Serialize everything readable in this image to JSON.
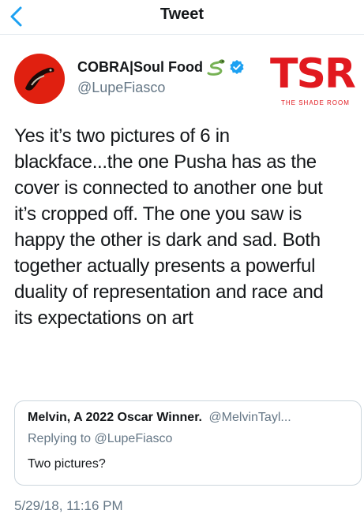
{
  "header": {
    "title": "Tweet",
    "back_icon": "chevron-left-icon",
    "accent_color": "#1da1f2"
  },
  "author": {
    "name": "COBRA|Soul Food",
    "name_emoji": "snake-icon",
    "verified_icon": "verified-badge-icon",
    "handle": "@LupeFiasco",
    "avatar_color": "#e02010"
  },
  "watermark": {
    "letters": "TSR",
    "subtitle": "THE SHADE ROOM",
    "color": "#e1191f"
  },
  "tweet": {
    "lines": [
      "Yes it’s two pictures of 6 in",
      "blackface...the one Pusha has as the",
      "cover is connected to another one but",
      "it’s cropped off. The one you saw is",
      "happy the other is dark and sad. Both",
      "together actually presents a powerful",
      "duality of representation and race and",
      "its expectations on art"
    ]
  },
  "quoted_tweet": {
    "name": "Melvin, A 2022 Oscar Winner.",
    "handle": "@MelvinTayl...",
    "reply_context": "Replying to @LupeFiasco",
    "text": "Two pictures?"
  },
  "meta": {
    "timestamp": "5/29/18, 11:16 PM"
  }
}
